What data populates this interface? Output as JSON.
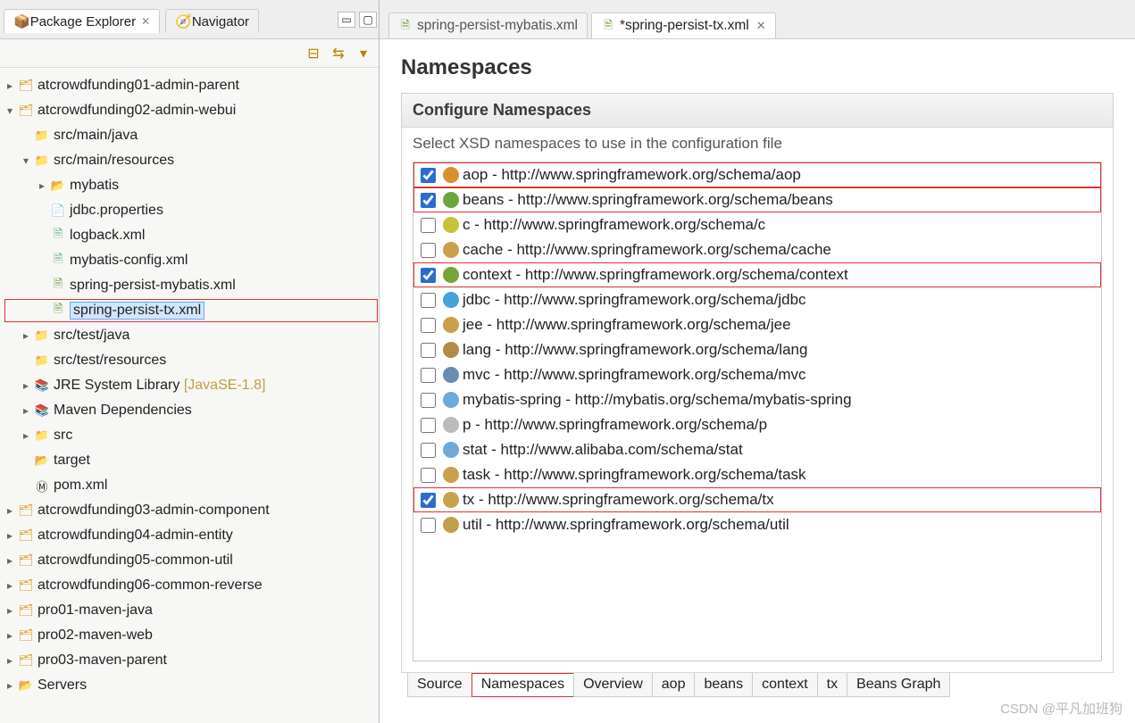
{
  "side_tabs": {
    "explorer": "Package Explorer",
    "navigator": "Navigator"
  },
  "tree": {
    "p1": "atcrowdfunding01-admin-parent",
    "p2": "atcrowdfunding02-admin-webui",
    "smj": "src/main/java",
    "smr": "src/main/resources",
    "mybatis": "mybatis",
    "jdbc": "jdbc.properties",
    "logback": "logback.xml",
    "mybcfg": "mybatis-config.xml",
    "spm": "spring-persist-mybatis.xml",
    "stx": "spring-persist-tx.xml",
    "stj": "src/test/java",
    "str": "src/test/resources",
    "jre": "JRE System Library",
    "jre_suffix": "[JavaSE-1.8]",
    "maven": "Maven Dependencies",
    "src": "src",
    "target": "target",
    "pom": "pom.xml",
    "p3": "atcrowdfunding03-admin-component",
    "p4": "atcrowdfunding04-admin-entity",
    "p5": "atcrowdfunding05-common-util",
    "p6": "atcrowdfunding06-common-reverse",
    "pm1": "pro01-maven-java",
    "pm2": "pro02-maven-web",
    "pm3": "pro03-maven-parent",
    "servers": "Servers"
  },
  "editor_tabs": {
    "t1": "spring-persist-mybatis.xml",
    "t2": "*spring-persist-tx.xml"
  },
  "page": {
    "title": "Namespaces",
    "section_title": "Configure Namespaces",
    "section_desc": "Select XSD namespaces to use in the configuration file"
  },
  "ns": [
    {
      "k": "aop",
      "checked": true,
      "hl": true,
      "ico": "nico-aop",
      "label": "aop - http://www.springframework.org/schema/aop"
    },
    {
      "k": "beans",
      "checked": true,
      "hl": true,
      "ico": "nico-beans",
      "label": "beans - http://www.springframework.org/schema/beans"
    },
    {
      "k": "c",
      "checked": false,
      "hl": false,
      "ico": "nico-c",
      "label": "c - http://www.springframework.org/schema/c"
    },
    {
      "k": "cache",
      "checked": false,
      "hl": false,
      "ico": "nico-task",
      "label": "cache - http://www.springframework.org/schema/cache"
    },
    {
      "k": "context",
      "checked": true,
      "hl": true,
      "ico": "nico-ctx",
      "label": "context - http://www.springframework.org/schema/context"
    },
    {
      "k": "jdbc",
      "checked": false,
      "hl": false,
      "ico": "nico-jdbc",
      "label": "jdbc - http://www.springframework.org/schema/jdbc"
    },
    {
      "k": "jee",
      "checked": false,
      "hl": false,
      "ico": "nico-task",
      "label": "jee - http://www.springframework.org/schema/jee"
    },
    {
      "k": "lang",
      "checked": false,
      "hl": false,
      "ico": "nico-lang",
      "label": "lang - http://www.springframework.org/schema/lang"
    },
    {
      "k": "mvc",
      "checked": false,
      "hl": false,
      "ico": "nico-mvc",
      "label": "mvc - http://www.springframework.org/schema/mvc"
    },
    {
      "k": "mybatis",
      "checked": false,
      "hl": false,
      "ico": "nico-s",
      "label": "mybatis-spring - http://mybatis.org/schema/mybatis-spring"
    },
    {
      "k": "p",
      "checked": false,
      "hl": false,
      "ico": "nico-p",
      "label": "p - http://www.springframework.org/schema/p"
    },
    {
      "k": "stat",
      "checked": false,
      "hl": false,
      "ico": "nico-s",
      "label": "stat - http://www.alibaba.com/schema/stat"
    },
    {
      "k": "task",
      "checked": false,
      "hl": false,
      "ico": "nico-task",
      "label": "task - http://www.springframework.org/schema/task"
    },
    {
      "k": "tx",
      "checked": true,
      "hl": true,
      "ico": "nico-tx",
      "label": "tx - http://www.springframework.org/schema/tx"
    },
    {
      "k": "util",
      "checked": false,
      "hl": false,
      "ico": "nico-util",
      "label": "util - http://www.springframework.org/schema/util"
    }
  ],
  "bottom_tabs": [
    "Source",
    "Namespaces",
    "Overview",
    "aop",
    "beans",
    "context",
    "tx",
    "Beans Graph"
  ],
  "bottom_active": 1,
  "watermark": "CSDN @平凡加班狗"
}
